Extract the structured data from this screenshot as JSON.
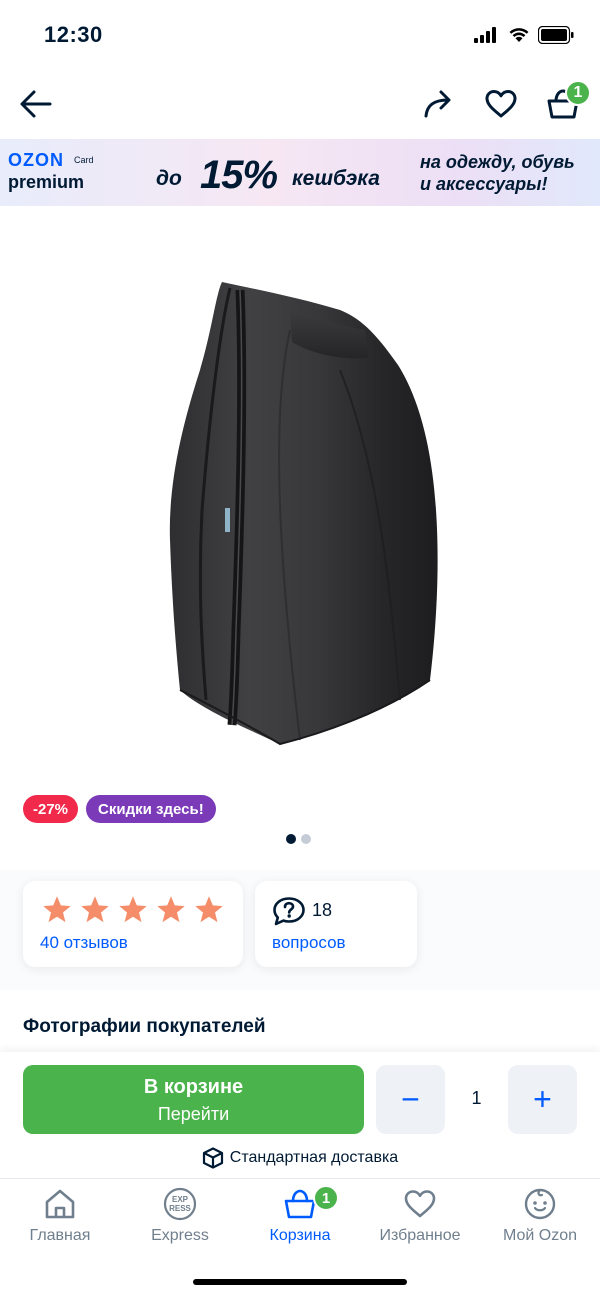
{
  "status_bar": {
    "time": "12:30"
  },
  "header": {
    "cart_count": "1"
  },
  "banner": {
    "brand": "OZON",
    "card": "Card",
    "premium": "premium",
    "prefix": "до",
    "percent": "15%",
    "cashback": "кешбэка",
    "line1": "на одежду, обувь",
    "line2": "и аксессуары!"
  },
  "product": {
    "image_alt": "Черный мешок",
    "tags": {
      "discount": "-27%",
      "sale": "Скидки здесь!"
    },
    "gallery": {
      "current": 1,
      "total": 2
    }
  },
  "rating": {
    "stars": 5,
    "reviews_label": "40 отзывов",
    "star_color": "#f58d6a"
  },
  "questions": {
    "count": "18",
    "label": "вопросов"
  },
  "customer_photos_title": "Фотографии покупателей",
  "cart_panel": {
    "button_title": "В корзине",
    "button_subtitle": "Перейти",
    "minus": "−",
    "plus": "+",
    "quantity": "1",
    "delivery": "Стандартная доставка"
  },
  "tabbar": {
    "home": "Главная",
    "express": "Express",
    "express_icon_top": "EXP",
    "express_icon_bottom": "RESS",
    "cart": "Корзина",
    "cart_badge": "1",
    "favorites": "Избранное",
    "profile": "Мой Ozon"
  },
  "colors": {
    "accent": "#005bff",
    "green": "#4bb34b",
    "discount": "#f1294b",
    "sale": "#7b3ab7"
  }
}
